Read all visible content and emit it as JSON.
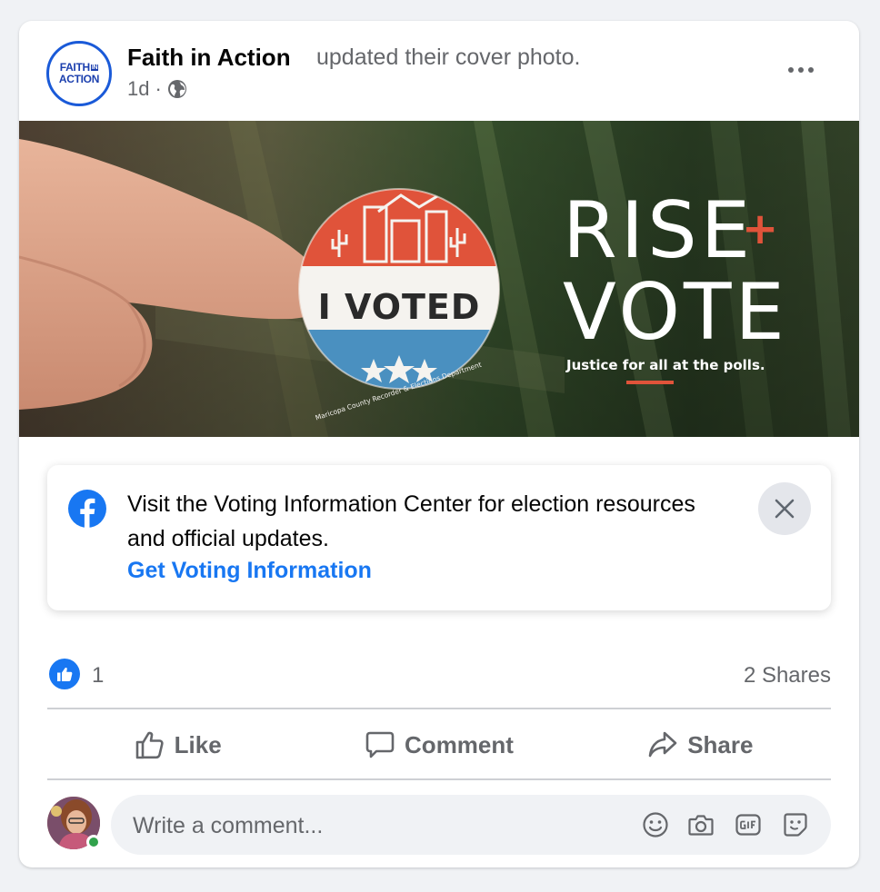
{
  "post": {
    "page_logo_line1": "FAITH",
    "page_logo_line1_small": "IN",
    "page_logo_line2": "ACTION",
    "page_name": "Faith in Action",
    "action_text": "updated their cover photo.",
    "time": "1d",
    "separator": "·",
    "privacy_icon": "globe-icon",
    "more_icon": "more-horizontal-icon"
  },
  "cover": {
    "sticker_text": "I VOTED",
    "sticker_ring_text": "Maricopa County Recorder & Elections Department",
    "headline_1": "RISE",
    "headline_plus": "+",
    "headline_2": "VOTE",
    "tagline": "Justice for all at the polls.",
    "colors": {
      "accent": "#e0533a",
      "sticker_red": "#e0533a",
      "sticker_blue": "#4a90c0"
    }
  },
  "voting_info": {
    "icon": "facebook-icon",
    "text": "Visit the Voting Information Center for election resources and official updates.",
    "link": "Get Voting Information",
    "close_icon": "close-icon"
  },
  "stats": {
    "like_icon": "like-thumb-icon",
    "like_count": "1",
    "shares": "2 Shares"
  },
  "actions": {
    "like": "Like",
    "comment": "Comment",
    "share": "Share"
  },
  "composer": {
    "placeholder": "Write a comment...",
    "icons": [
      "emoji-icon",
      "camera-icon",
      "gif-icon",
      "sticker-icon"
    ]
  },
  "colors": {
    "brand_blue": "#1877f2",
    "secondary_text": "#65676b",
    "online_green": "#31a24c"
  }
}
